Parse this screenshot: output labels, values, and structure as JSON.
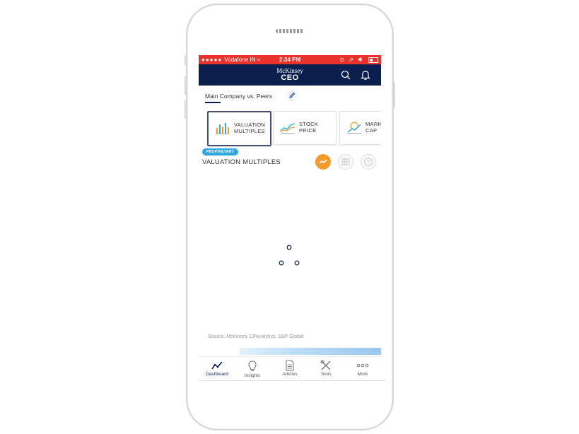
{
  "status_bar": {
    "carrier": "Vodafone IN",
    "time": "2:34 PM",
    "background": "#e8322b"
  },
  "app_bar": {
    "logo_line1": "McKinsey",
    "logo_line2": "CEO",
    "background": "#0b1f4f"
  },
  "comparison": {
    "label": "Main Company vs. Peers"
  },
  "cards": [
    {
      "line1": "VALUATION",
      "line2": "MULTIPLES",
      "icon": "bar-chart-icon"
    },
    {
      "line1": "STOCK",
      "line2": "PRICE",
      "icon": "line-chart-icon"
    },
    {
      "line1": "MARK",
      "line2": "CAP",
      "icon": "market-cap-icon"
    }
  ],
  "section": {
    "badge": "PROPRIETARY",
    "title": "VALUATION MULTIPLES",
    "accent": "#f39a2c"
  },
  "source": "Source: McKinsey CPAnalytics, S&P Global",
  "tabs": [
    {
      "label": "Dashboard",
      "icon": "dashboard-icon"
    },
    {
      "label": "Insights",
      "icon": "lightbulb-icon"
    },
    {
      "label": "Articles",
      "icon": "document-icon"
    },
    {
      "label": "Tools",
      "icon": "tools-icon"
    },
    {
      "label": "More",
      "icon": "more-icon"
    }
  ]
}
